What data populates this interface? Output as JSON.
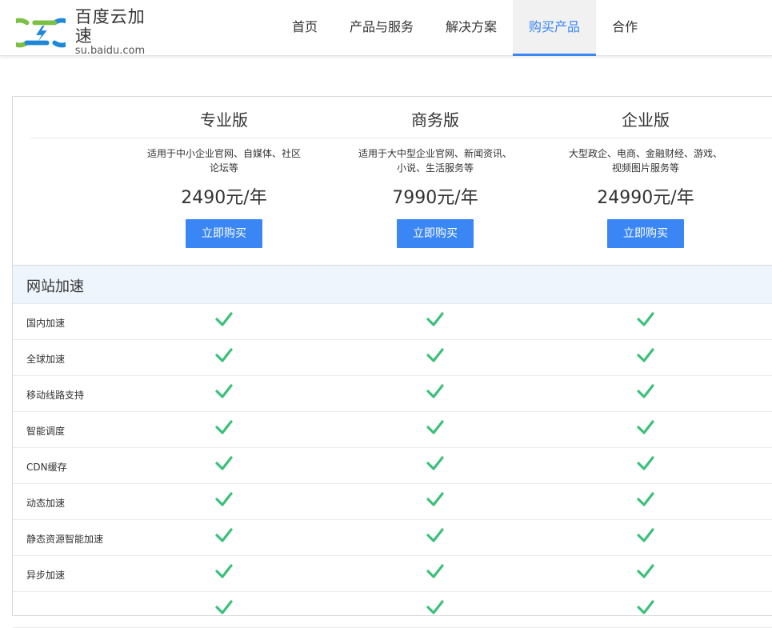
{
  "header": {
    "logo": {
      "name": "百度云加速",
      "domain": "su.baidu.com"
    },
    "nav": [
      "首页",
      "产品与服务",
      "解决方案",
      "购买产品",
      "合作"
    ],
    "active_nav": "购买产品"
  },
  "plans": [
    {
      "name": "专业版",
      "desc_line1": "适用于中小企业官网、自媒体、社区",
      "desc_line2": "论坛等",
      "price": "2490元/年",
      "button": "立即购买"
    },
    {
      "name": "商务版",
      "desc_line1": "适用于大中型企业官网、新闻资讯、",
      "desc_line2": "小说、生活服务等",
      "price": "7990元/年",
      "button": "立即购买"
    },
    {
      "name": "企业版",
      "desc_line1": "大型政企、电商、金融财经、游戏、",
      "desc_line2": "视频图片服务等",
      "price": "24990元/年",
      "button": "立即购买"
    }
  ],
  "section": {
    "title": "网站加速",
    "features": [
      "国内加速",
      "全球加速",
      "移动线路支持",
      "智能调度",
      "CDN缓存",
      "动态加速",
      "静态资源智能加速",
      "异步加速",
      ""
    ]
  },
  "colors": {
    "accent": "#3a86f5",
    "check": "#3cc07a",
    "logo_blue": "#1e88d8",
    "logo_green": "#7cc043"
  }
}
